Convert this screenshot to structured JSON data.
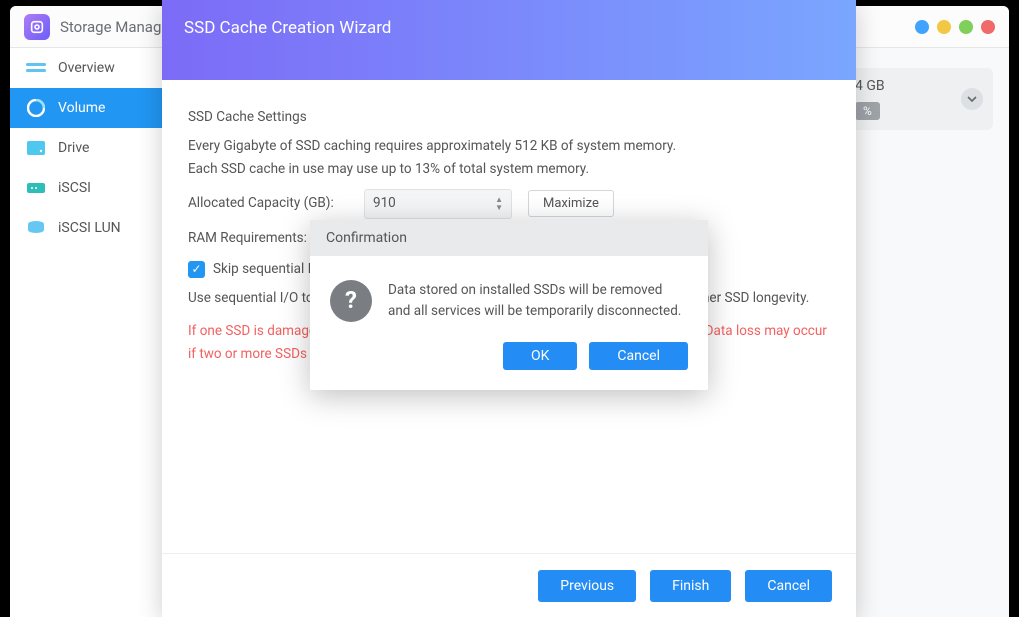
{
  "titlebar": {
    "app_name": "Storage Manag"
  },
  "sidebar": {
    "items": [
      {
        "label": "Overview"
      },
      {
        "label": "Volume"
      },
      {
        "label": "Drive"
      },
      {
        "label": "iSCSI"
      },
      {
        "label": "iSCSI LUN"
      }
    ]
  },
  "info_card": {
    "size": "4 GB",
    "pct": "%"
  },
  "wizard": {
    "title": "SSD Cache Creation Wizard",
    "settings_heading": "SSD Cache Settings",
    "line1": "Every Gigabyte of SSD caching requires approximately 512 KB of system memory.",
    "line2": "Each SSD cache in use may use up to 13% of total system memory.",
    "capacity_label": "Allocated Capacity (GB):",
    "capacity_value": "910",
    "maximize": "Maximize",
    "ram_label": "RAM Requirements:",
    "skip_label": "Skip sequential I/O",
    "seq_desc": "Use sequential I/O to reduce cache writes, extend the lifespan of SSDs, and ensure higher SSD longevity.",
    "warning": "If one SSD is damaged, the system can still ensure the integrity of data on the volume. Data loss may occur if two or more SSDs fail.",
    "previous": "Previous",
    "finish": "Finish",
    "cancel": "Cancel"
  },
  "dialog": {
    "title": "Confirmation",
    "message": "Data stored on installed SSDs will be removed and all services will be temporarily disconnected.",
    "ok": "OK",
    "cancel": "Cancel"
  }
}
